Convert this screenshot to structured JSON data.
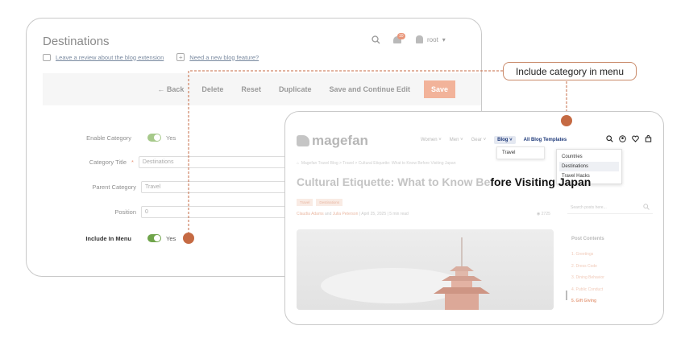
{
  "admin": {
    "title": "Destinations",
    "review_link": "Leave a review about the blog extension",
    "feature_link": "Need a new blog feature?",
    "notification_count": "10",
    "user_name": "root",
    "actions": {
      "back": "Back",
      "delete": "Delete",
      "reset": "Reset",
      "duplicate": "Duplicate",
      "save_continue": "Save and Continue Edit",
      "save": "Save"
    },
    "fields": {
      "enable_category": {
        "label": "Enable Category",
        "value": "Yes"
      },
      "category_title": {
        "label": "Category Title",
        "required": "*",
        "value": "Destinations"
      },
      "parent_category": {
        "label": "Parent Category",
        "value": "Travel"
      },
      "position": {
        "label": "Position",
        "value": "0"
      },
      "include_in_menu": {
        "label": "Include In Menu",
        "value": "Yes"
      }
    }
  },
  "callout": {
    "text": "Include category in menu"
  },
  "front": {
    "logo": "magefan",
    "nav": {
      "women": "Women",
      "men": "Men",
      "gear": "Gear",
      "blog": "Blog",
      "templates": "All Blog Templates"
    },
    "blog_dropdown": [
      "Travel"
    ],
    "sub_dropdown": [
      "Countries",
      "Destinations",
      "Travel Hacks"
    ],
    "breadcrumb": "Magefan Travel Blog  >  Travel  >  Cultural Etiquette: What to Know Before Visiting Japan",
    "title_faded": "Cultural Etiquette: What to Know Be",
    "title_dark": "fore Visiting Japan",
    "tags": [
      "Travel",
      "Destinations"
    ],
    "meta_authors": "Claudia Adams",
    "meta_and": "and",
    "meta_author2": "Julia Peterson",
    "meta_rest": "|  April 25, 2025  |  5 min read",
    "views": "2725",
    "search_placeholder": "Search posts here...",
    "toc_title": "Post Contents",
    "toc": [
      "1. Greetings",
      "2. Dress Code",
      "3. Dining Behavior",
      "4. Public Conduct",
      "5. Gift Giving"
    ]
  },
  "colors": {
    "accent": "#c56a43",
    "save_button": "#f2b39a",
    "toggle": "#6fa44a",
    "nav_blue": "#1f3a7a"
  }
}
